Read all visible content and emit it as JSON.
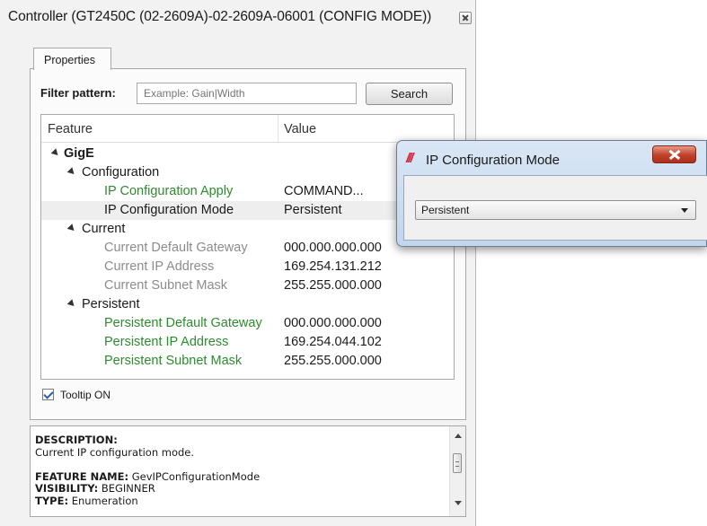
{
  "window": {
    "title": "Controller  (GT2450C (02-2609A)-02-2609A-06001 (CONFIG MODE))"
  },
  "tabs": [
    {
      "label": "Properties"
    }
  ],
  "filter": {
    "label": "Filter pattern:",
    "placeholder": "Example: Gain|Width",
    "search_label": "Search"
  },
  "grid": {
    "columns": [
      "Feature",
      "Value"
    ],
    "rows": [
      {
        "name": "GigE",
        "value": ""
      },
      {
        "name": "Configuration",
        "value": ""
      },
      {
        "name": "IP Configuration Apply",
        "value": "COMMAND..."
      },
      {
        "name": "IP Configuration Mode",
        "value": "Persistent"
      },
      {
        "name": "Current",
        "value": ""
      },
      {
        "name": "Current Default Gateway",
        "value": "000.000.000.000"
      },
      {
        "name": "Current IP Address",
        "value": "169.254.131.212"
      },
      {
        "name": "Current Subnet Mask",
        "value": "255.255.000.000"
      },
      {
        "name": "Persistent",
        "value": ""
      },
      {
        "name": "Persistent Default Gateway",
        "value": "000.000.000.000"
      },
      {
        "name": "Persistent IP Address",
        "value": "169.254.044.102"
      },
      {
        "name": "Persistent Subnet Mask",
        "value": "255.255.000.000"
      }
    ]
  },
  "tooltip": {
    "label": "Tooltip ON",
    "checked": true
  },
  "description": {
    "heading": "DESCRIPTION:",
    "text": "Current IP configuration mode.",
    "feature_name_label": "FEATURE NAME:",
    "feature_name": "GevIPConfigurationMode",
    "visibility_label": "VISIBILITY:",
    "visibility": "BEGINNER",
    "type_label": "TYPE:",
    "type": "Enumeration"
  },
  "popup": {
    "logo": "///",
    "title": "IP Configuration Mode",
    "selected": "Persistent"
  },
  "colors": {
    "writable_feature": "#2e8b2e",
    "readonly_feature": "#8c8c8c",
    "popup_close": "#c0402a"
  }
}
